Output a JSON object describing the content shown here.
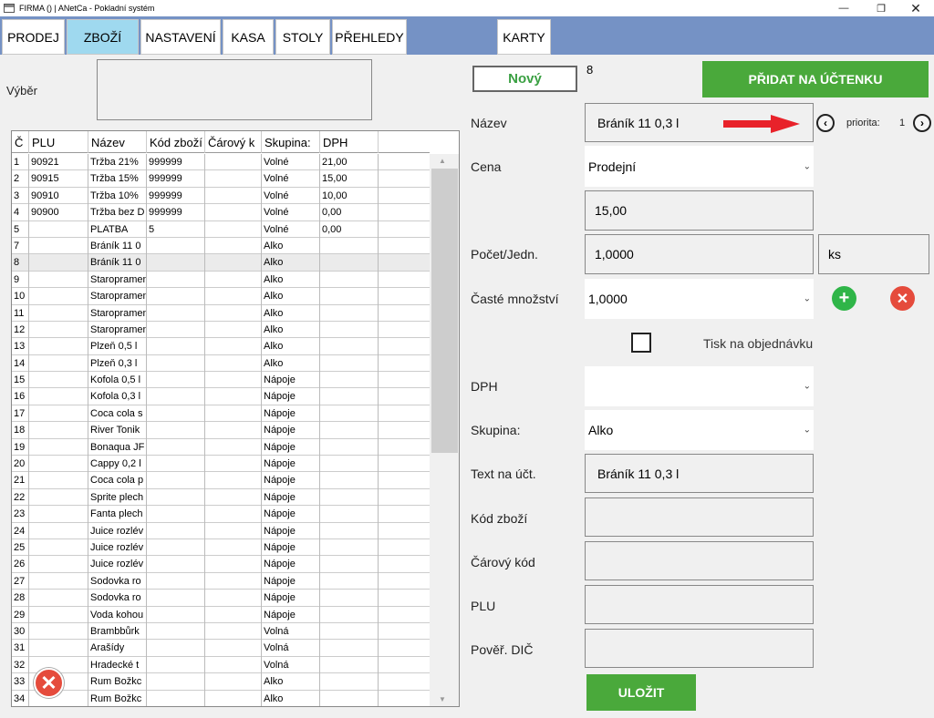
{
  "window": {
    "title": "FIRMA () | ANetCa - Pokladní systém",
    "minimize_icon": "minimize-icon",
    "restore_icon": "restore-icon",
    "close_icon": "close-icon"
  },
  "tabs": [
    {
      "label": "PRODEJ",
      "active": false
    },
    {
      "label": "ZBOŽÍ",
      "active": true
    },
    {
      "label": "NASTAVENÍ",
      "active": false
    },
    {
      "label": "KASA",
      "active": false
    },
    {
      "label": "STOLY",
      "active": false
    },
    {
      "label": "PŘEHLEDY",
      "active": false
    },
    {
      "label": "KARTY",
      "active": false
    }
  ],
  "left": {
    "vyber_label": "Výběr",
    "columns": [
      "Č",
      "PLU",
      "Název",
      "Kód zboží",
      "Čárový k",
      "Skupina:",
      "DPH"
    ],
    "rows": [
      [
        "1",
        "90921",
        "Tržba 21%",
        "999999",
        "",
        "Volné",
        "21,00"
      ],
      [
        "2",
        "90915",
        "Tržba 15%",
        "999999",
        "",
        "Volné",
        "15,00"
      ],
      [
        "3",
        "90910",
        "Tržba 10%",
        "999999",
        "",
        "Volné",
        "10,00"
      ],
      [
        "4",
        "90900",
        "Tržba bez D",
        "999999",
        "",
        "Volné",
        "0,00"
      ],
      [
        "5",
        "",
        "PLATBA",
        "5",
        "",
        "Volné",
        "0,00"
      ],
      [
        "7",
        "",
        "Bráník 11 0",
        "",
        "",
        "Alko",
        ""
      ],
      [
        "8",
        "",
        "Bráník 11 0",
        "",
        "",
        "Alko",
        ""
      ],
      [
        "9",
        "",
        "Staropramen",
        "",
        "",
        "Alko",
        ""
      ],
      [
        "10",
        "",
        "Staropramen",
        "",
        "",
        "Alko",
        ""
      ],
      [
        "11",
        "",
        "Staropramen",
        "",
        "",
        "Alko",
        ""
      ],
      [
        "12",
        "",
        "Staropramen",
        "",
        "",
        "Alko",
        ""
      ],
      [
        "13",
        "",
        "Plzeň 0,5 l",
        "",
        "",
        "Alko",
        ""
      ],
      [
        "14",
        "",
        "Plzeň 0,3 l",
        "",
        "",
        "Alko",
        ""
      ],
      [
        "15",
        "",
        "Kofola 0,5 l",
        "",
        "",
        "Nápoje",
        ""
      ],
      [
        "16",
        "",
        "Kofola 0,3 l",
        "",
        "",
        "Nápoje",
        ""
      ],
      [
        "17",
        "",
        "Coca cola s",
        "",
        "",
        "Nápoje",
        ""
      ],
      [
        "18",
        "",
        "River Tonik",
        "",
        "",
        "Nápoje",
        ""
      ],
      [
        "19",
        "",
        "Bonaqua JF",
        "",
        "",
        "Nápoje",
        ""
      ],
      [
        "20",
        "",
        "Cappy 0,2 l",
        "",
        "",
        "Nápoje",
        ""
      ],
      [
        "21",
        "",
        "Coca cola p",
        "",
        "",
        "Nápoje",
        ""
      ],
      [
        "22",
        "",
        "Sprite plech",
        "",
        "",
        "Nápoje",
        ""
      ],
      [
        "23",
        "",
        "Fanta plech",
        "",
        "",
        "Nápoje",
        ""
      ],
      [
        "24",
        "",
        "Juice rozlév",
        "",
        "",
        "Nápoje",
        ""
      ],
      [
        "25",
        "",
        "Juice rozlév",
        "",
        "",
        "Nápoje",
        ""
      ],
      [
        "26",
        "",
        "Juice rozlév",
        "",
        "",
        "Nápoje",
        ""
      ],
      [
        "27",
        "",
        "Sodovka ro",
        "",
        "",
        "Nápoje",
        ""
      ],
      [
        "28",
        "",
        "Sodovka ro",
        "",
        "",
        "Nápoje",
        ""
      ],
      [
        "29",
        "",
        "Voda kohou",
        "",
        "",
        "Nápoje",
        ""
      ],
      [
        "30",
        "",
        "Brambbůrk",
        "",
        "",
        "Volná",
        ""
      ],
      [
        "31",
        "",
        "Arašídy",
        "",
        "",
        "Volná",
        ""
      ],
      [
        "32",
        "",
        "Hradecké t",
        "",
        "",
        "Volná",
        ""
      ],
      [
        "33",
        "",
        "Rum Božkc",
        "",
        "",
        "Alko",
        ""
      ],
      [
        "34",
        "",
        "Rum Božkc",
        "",
        "",
        "Alko",
        ""
      ]
    ],
    "selected_row": 6,
    "delete_icon": "close-circle-icon"
  },
  "right": {
    "novy_label": "Nový",
    "count": "8",
    "add_to_receipt_label": "PŘIDAT NA ÚČTENKU",
    "nazev_label": "Název",
    "nazev_value": "Bráník 11 0,3 l",
    "priority_label": "priorita:",
    "priority_value": "1",
    "cena_label": "Cena",
    "cena_type": "Prodejní",
    "cena_value": "15,00",
    "pocet_label": "Počet/Jedn.",
    "pocet_value": "1,0000",
    "unit_value": "ks",
    "caste_label": "Časté množství",
    "caste_value": "1,0000",
    "tisk_label": "Tisk na objednávku",
    "dph_label": "DPH",
    "dph_value": "",
    "skupina_label": "Skupina:",
    "skupina_value": "Alko",
    "text_label": "Text na účt.",
    "text_value": "Bráník 11 0,3 l",
    "kod_label": "Kód zboží",
    "kod_value": "",
    "carovy_label": "Čárový kód",
    "carovy_value": "",
    "plu_label": "PLU",
    "plu_value": "",
    "dic_label": "Pověř. DIČ",
    "dic_value": "",
    "save_label": "ULOŽIT",
    "colors": {
      "green": "#4aa93b",
      "red": "#e54b3c",
      "add_green": "#2fb548",
      "tab_bar": "#7592c5",
      "tab_active": "#9fd9ef"
    }
  }
}
